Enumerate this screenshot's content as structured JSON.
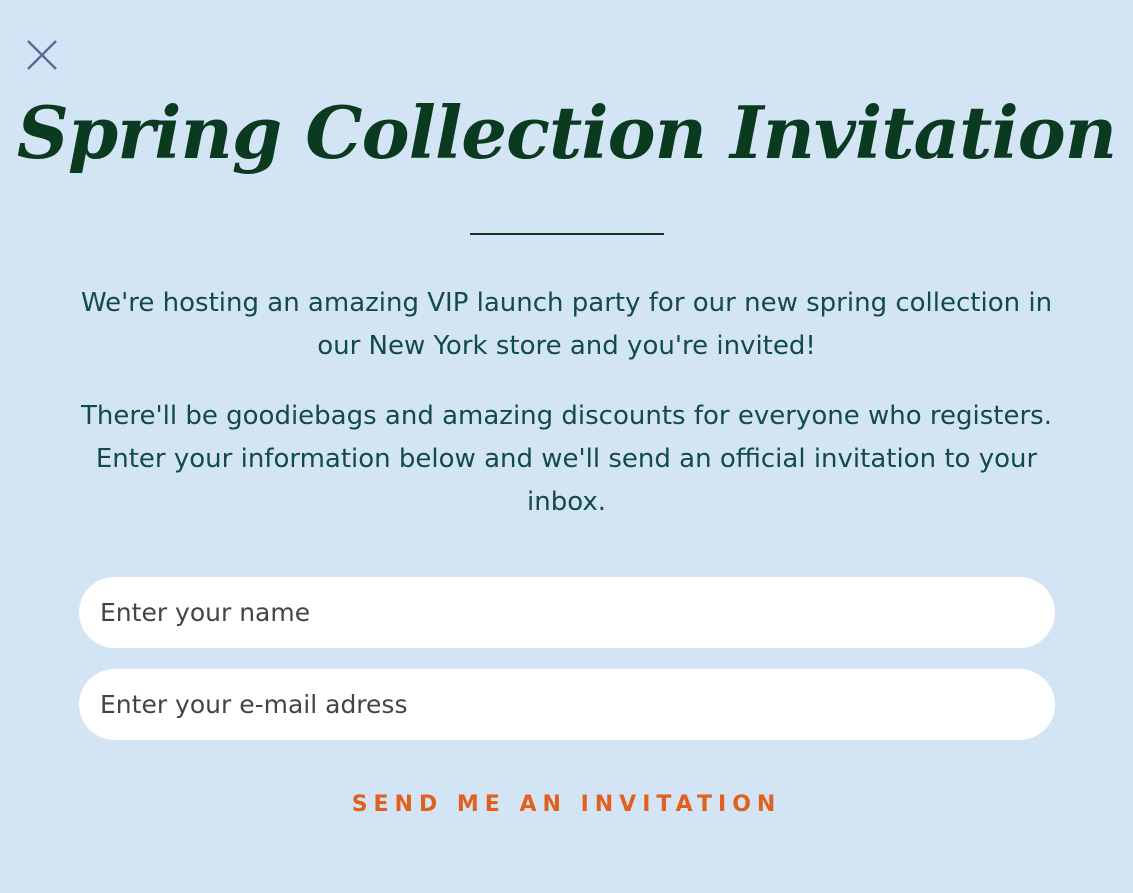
{
  "modal": {
    "title": "Spring Collection Invitation",
    "paragraph_1": "We're hosting an amazing VIP launch party for our new spring collection in our New York store and you're invited!",
    "paragraph_2": "There'll be goodiebags and amazing discounts for everyone who registers. Enter your information below and we'll send an official invitation to your inbox.",
    "name_placeholder": "Enter your name",
    "email_placeholder": "Enter your e-mail adress",
    "submit_label": "SEND ME AN INVITATION",
    "close_icon": "close-icon"
  },
  "colors": {
    "background": "#d3e5f5",
    "title": "#0a3a1f",
    "body_text": "#124a4e",
    "accent": "#e0601e",
    "close_icon": "#5b6b9a"
  }
}
